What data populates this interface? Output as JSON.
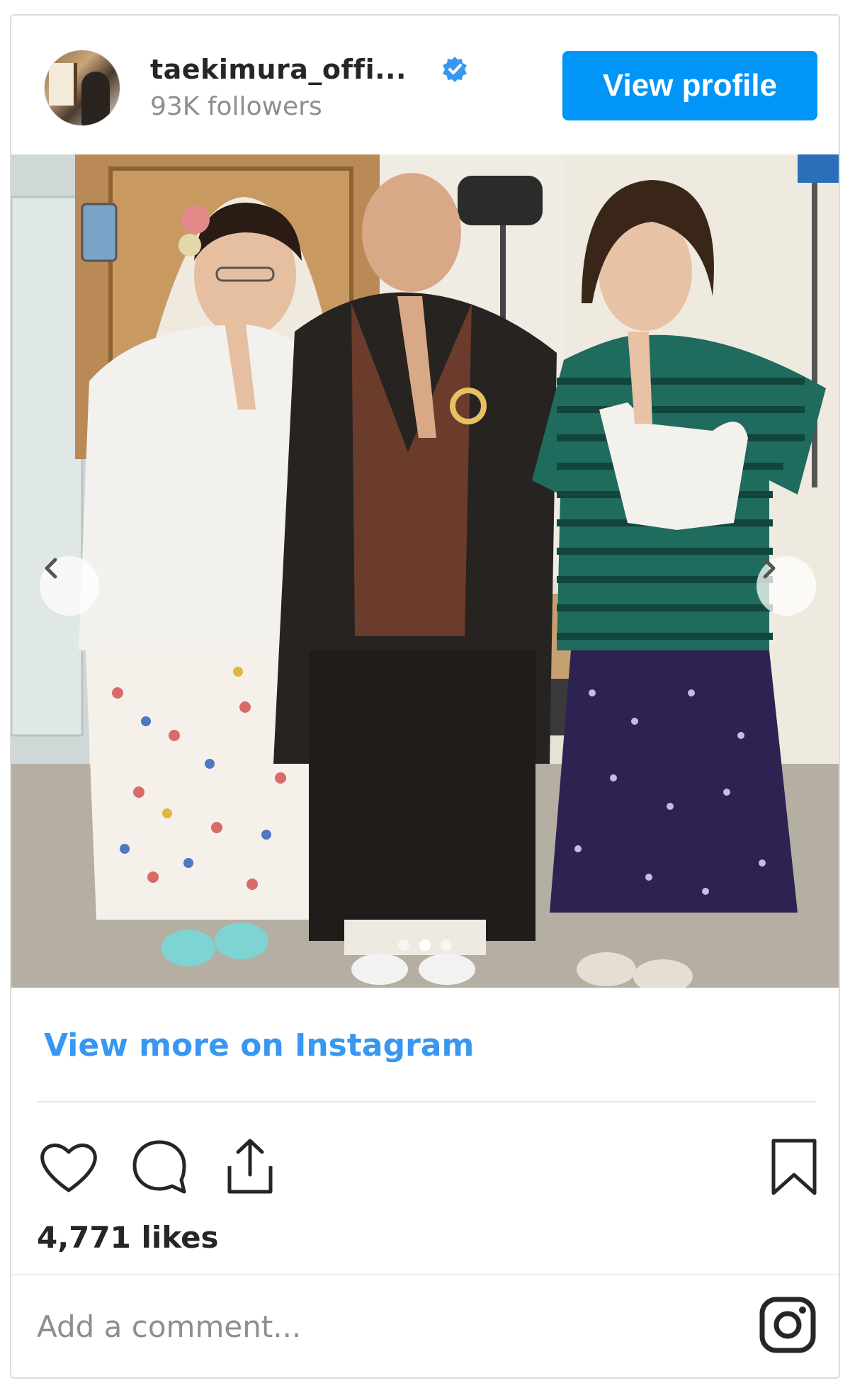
{
  "post": {
    "username": "taekimura_offi...",
    "verified": true,
    "followers": "93K followers",
    "view_profile_label": "View profile",
    "view_more_label": "View more on Instagram",
    "likes": "4,771 likes",
    "comment_placeholder": "Add a comment...",
    "carousel": {
      "total": 3,
      "active_index": 1
    }
  },
  "icons": {
    "verified": "verified-badge-icon",
    "prev": "chevron-left-icon",
    "next": "chevron-right-icon",
    "like": "heart-icon",
    "comment": "comment-bubble-icon",
    "share": "share-icon",
    "save": "bookmark-icon",
    "logo": "instagram-logo-icon"
  },
  "colors": {
    "accent": "#0095f6",
    "link": "#3897f0",
    "text": "#262626",
    "muted": "#8e8e8e",
    "border": "#dbdbdb"
  }
}
